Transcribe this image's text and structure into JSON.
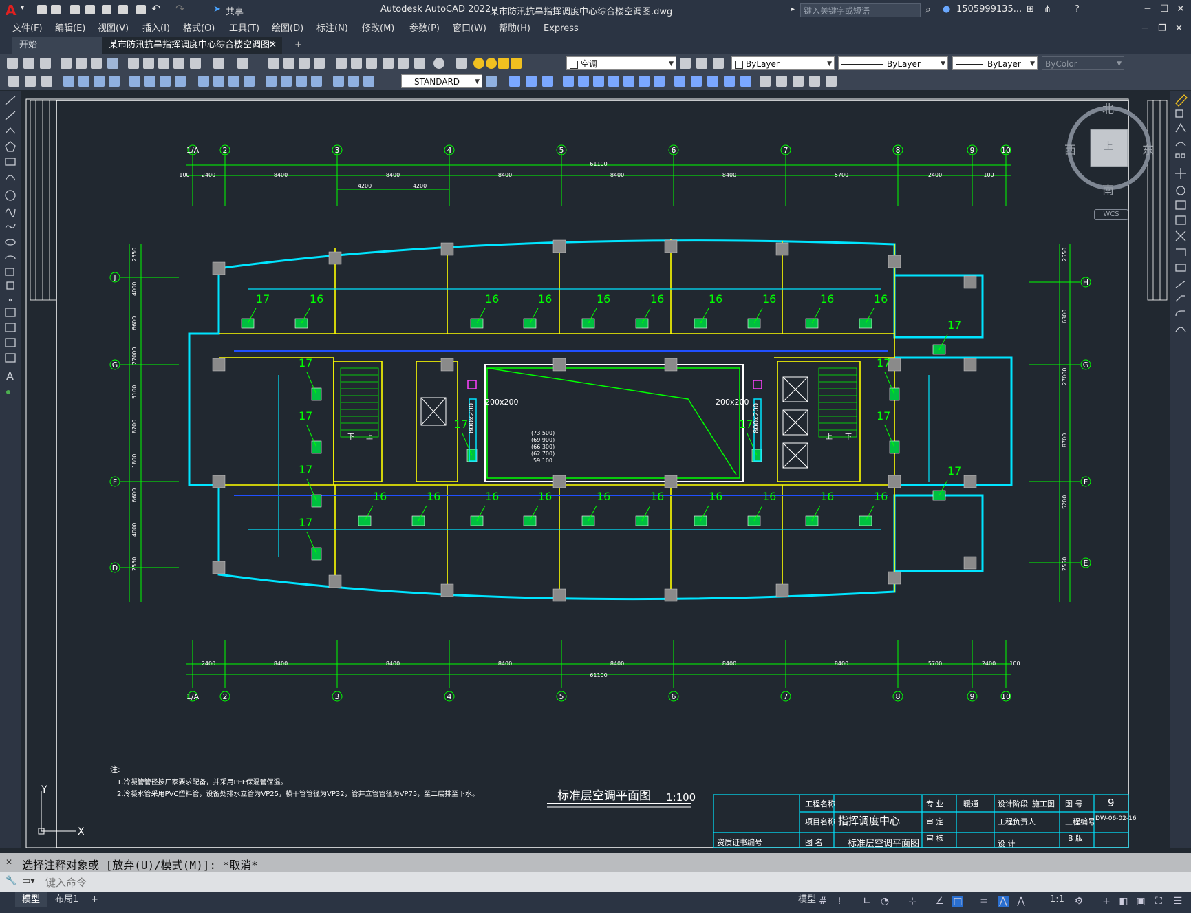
{
  "titlebar": {
    "app_title": "Autodesk AutoCAD 2022",
    "filename": "某市防汛抗旱指挥调度中心综合楼空调图.dwg",
    "share_label": "共享",
    "search_placeholder": "键入关键字或短语",
    "user": "1505999135...",
    "help": "?"
  },
  "menu": [
    "文件(F)",
    "编辑(E)",
    "视图(V)",
    "插入(I)",
    "格式(O)",
    "工具(T)",
    "绘图(D)",
    "标注(N)",
    "修改(M)",
    "参数(P)",
    "窗口(W)",
    "帮助(H)",
    "Express"
  ],
  "tabs": {
    "start": "开始",
    "drawing": "某市防汛抗旱指挥调度中心综合楼空调图*"
  },
  "toolbar": {
    "layer": "空调",
    "color": "ByLayer",
    "linetype": "ByLayer",
    "lineweight": "ByLayer",
    "plotstyle": "ByColor",
    "textstyle": "STANDARD"
  },
  "viewcube": {
    "north": "北",
    "south": "南",
    "west": "西",
    "east": "东",
    "top": "上",
    "wcs": "WCS"
  },
  "drawing": {
    "grid_top": [
      "1/A",
      "2",
      "3",
      "4",
      "5",
      "6",
      "7",
      "8",
      "9",
      "10"
    ],
    "grid_left": [
      "J",
      "G",
      "F",
      "D"
    ],
    "grid_right": [
      "H",
      "G",
      "F",
      "E"
    ],
    "dims_top": [
      "100",
      "2400",
      "8400",
      "8400",
      "8400",
      "8400",
      "8400",
      "5700",
      "2400",
      "100"
    ],
    "dims_top_sub": [
      "4200",
      "4200"
    ],
    "total_dim": "61100",
    "dims_bottom": [
      "2400",
      "8400",
      "8400",
      "8400",
      "8400",
      "8400",
      "8400",
      "5700",
      "2400",
      "100"
    ],
    "dims_left": [
      "2550",
      "4000",
      "6600",
      "27000",
      "5100",
      "8700",
      "1800",
      "6600",
      "4000",
      "2550"
    ],
    "dims_right": [
      "2550",
      "6300",
      "27000",
      "8700",
      "5200",
      "2550"
    ],
    "unit_16": "16",
    "unit_17": "17",
    "duct_left": "200x200",
    "duct_right": "200x200",
    "shaft_left": "800x200",
    "shaft_right": "800x200",
    "elevations": [
      "(73.500)",
      "(69.900)",
      "(66.300)",
      "(62.700)",
      "59.100"
    ],
    "stair_down": "下",
    "stair_up": "上",
    "plan_title": "标准层空调平面图",
    "plan_scale": "1:100",
    "notes_title": "注:",
    "note1": "1.冷凝管管径按厂家要求配备，并采用PEF保温管保温。",
    "note2": "2.冷凝水管采用PVC塑料管，设备处排水立管为VP25，横干管管径为VP32，管井立管管径为VP75，至二层排至下水。",
    "titleblock": {
      "project_label": "工程名称",
      "item_label": "项目名称",
      "item_value": "指挥调度中心",
      "drawing_label": "图  名",
      "drawing_value": "标准层空调平面图",
      "cert_label": "资质证书编号",
      "major_label": "专  业",
      "major_value": "暖通",
      "stage_label": "设计阶段",
      "stage_value": "施工图",
      "sheet_label": "图  号",
      "sheet_value": "9",
      "approve_label": "审  定",
      "owner_label": "工程负责人",
      "code_label": "工程编号",
      "code_value": "DW-06-02-16",
      "review_label": "审  核",
      "design_label": "设  计",
      "version_label": "B  版"
    }
  },
  "command": {
    "history": "选择注释对象或 [放弃(U)/模式(M)]: *取消*",
    "placeholder": "键入命令"
  },
  "status": {
    "model_tab": "模型",
    "layout1": "布局1",
    "model_btn": "模型",
    "scale": "1:1"
  },
  "colors": {
    "grid": "#00ff00",
    "wall": "#00ffff",
    "yellow": "#ffff00",
    "duct": "#00ffff",
    "bg": "#212830"
  }
}
